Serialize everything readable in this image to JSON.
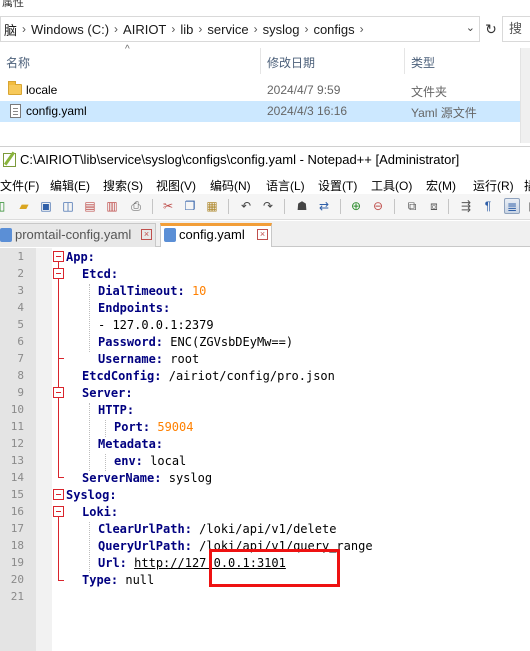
{
  "explorer": {
    "top_fragment": "属性",
    "breadcrumb": [
      "脑",
      "Windows (C:)",
      "AIRIOT",
      "lib",
      "service",
      "syslog",
      "configs"
    ],
    "search_fragment": "搜",
    "columns": {
      "name": "名称",
      "modified": "修改日期",
      "type": "类型"
    },
    "files": [
      {
        "name": "locale",
        "modified": "2024/4/7 9:59",
        "type": "文件夹",
        "icon": "folder-icon"
      },
      {
        "name": "config.yaml",
        "modified": "2024/4/3 16:16",
        "type": "Yaml 源文件",
        "icon": "file-icon",
        "selected": true
      }
    ]
  },
  "notepad": {
    "title": "C:\\AIRIOT\\lib\\service\\syslog\\configs\\config.yaml - Notepad++ [Administrator]",
    "menu": [
      "文件(F)",
      "编辑(E)",
      "搜索(S)",
      "视图(V)",
      "编码(N)",
      "语言(L)",
      "设置(T)",
      "工具(O)",
      "宏(M)",
      "运行(R)",
      "插"
    ],
    "tabs": [
      {
        "label": "promtail-config.yaml",
        "active": false
      },
      {
        "label": "config.yaml",
        "active": true
      }
    ],
    "line_numbers": [
      "1",
      "2",
      "3",
      "4",
      "5",
      "6",
      "7",
      "8",
      "9",
      "10",
      "11",
      "12",
      "13",
      "14",
      "15",
      "16",
      "17",
      "18",
      "19",
      "20",
      "21"
    ],
    "code": {
      "l1": "App:",
      "l2": "Etcd:",
      "l3_key": "DialTimeout:",
      "l3_val": "10",
      "l4": "Endpoints:",
      "l5": "- 127.0.0.1:2379",
      "l6_key": "Password:",
      "l6_val": "ENC(ZGVsbDEyMw==)",
      "l7_key": "Username:",
      "l7_val": "root",
      "l8_key": "EtcdConfig:",
      "l8_val": "/airiot/config/pro.json",
      "l9": "Server:",
      "l10": "HTTP:",
      "l11_key": "Port:",
      "l11_val": "59004",
      "l12": "Metadata:",
      "l13_key": "env:",
      "l13_val": "local",
      "l14_key": "ServerName:",
      "l14_val": "syslog",
      "l15": "Syslog:",
      "l16": "Loki:",
      "l17_key": "ClearUrlPath:",
      "l17_val": "/loki/api/v1/delete",
      "l18_key": "QueryUrlPath:",
      "l18_val": "/loki/api/v1/query_range",
      "l19_key": "Url:",
      "l19_val": "http://127.0.0.1:3101",
      "l20_key": "Type:",
      "l20_val": "null"
    }
  },
  "colors": {
    "keyword": "#000080",
    "number": "#ff8000",
    "fold_marker": "#d9242c",
    "annotation": "#ee1111",
    "selection": "#cce8ff"
  }
}
